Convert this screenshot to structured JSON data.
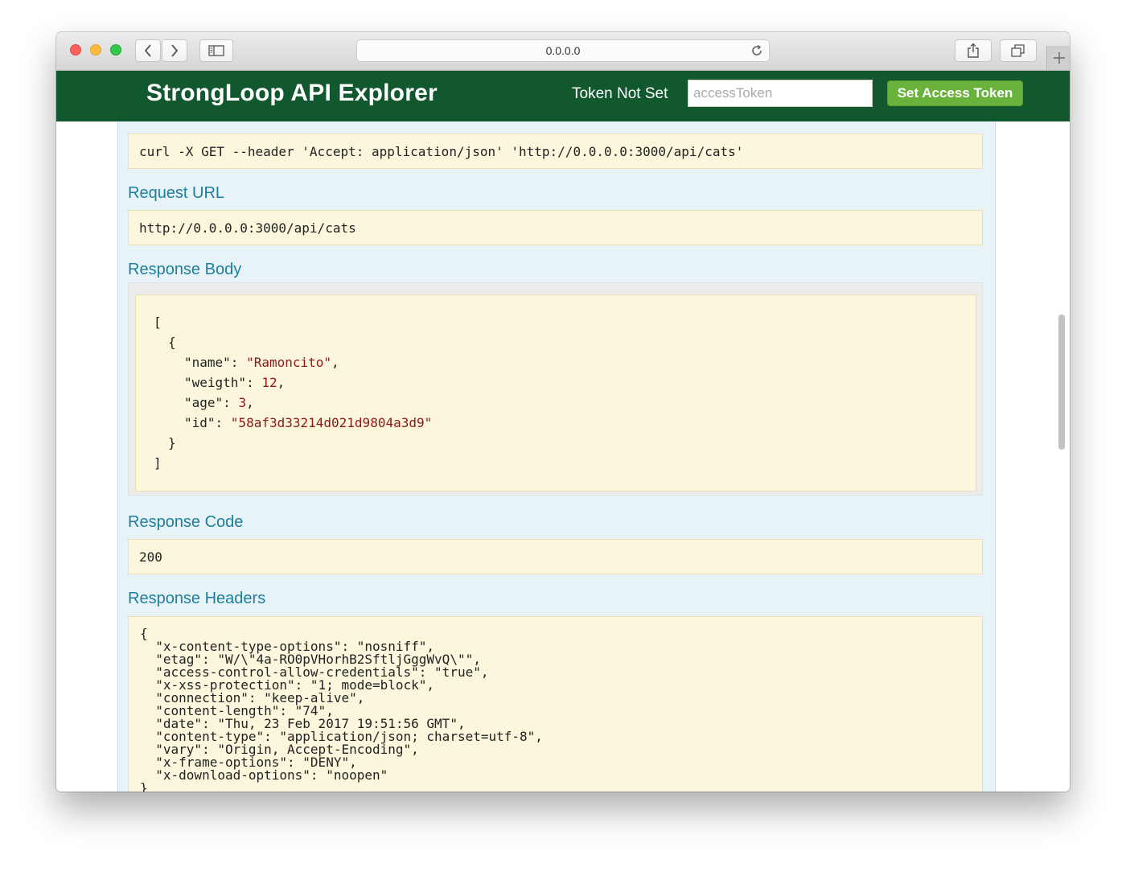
{
  "browser": {
    "url": "0.0.0.0"
  },
  "header": {
    "title": "StrongLoop API Explorer",
    "token_status": "Token Not Set",
    "token_placeholder": "accessToken",
    "set_token_label": "Set Access Token",
    "brand_color": "#11582e",
    "button_color": "#69b33c"
  },
  "curl": {
    "command": "curl -X GET --header 'Accept: application/json' 'http://0.0.0.0:3000/api/cats'"
  },
  "request_url": {
    "heading": "Request URL",
    "value": "http://0.0.0.0:3000/api/cats"
  },
  "response_body": {
    "heading": "Response Body",
    "open_bracket": "[",
    "open_brace": "{",
    "close_brace": "}",
    "close_bracket": "]",
    "fields": [
      {
        "key": "\"name\"",
        "value": "\"Ramoncito\"",
        "sep": ","
      },
      {
        "key": "\"weigth\"",
        "value": "12",
        "sep": ","
      },
      {
        "key": "\"age\"",
        "value": "3",
        "sep": ","
      },
      {
        "key": "\"id\"",
        "value": "\"58af3d33214d021d9804a3d9\"",
        "sep": ""
      }
    ]
  },
  "response_code": {
    "heading": "Response Code",
    "value": "200"
  },
  "response_headers": {
    "heading": "Response Headers",
    "lines": [
      "{",
      "  \"x-content-type-options\": \"nosniff\",",
      "  \"etag\": \"W/\\\"4a-RO0pVHorhB2SftljGggWvQ\\\"\",",
      "  \"access-control-allow-credentials\": \"true\",",
      "  \"x-xss-protection\": \"1; mode=block\",",
      "  \"connection\": \"keep-alive\",",
      "  \"content-length\": \"74\",",
      "  \"date\": \"Thu, 23 Feb 2017 19:51:56 GMT\",",
      "  \"content-type\": \"application/json; charset=utf-8\",",
      "  \"vary\": \"Origin, Accept-Encoding\",",
      "  \"x-frame-options\": \"DENY\",",
      "  \"x-download-options\": \"noopen\"",
      "}"
    ]
  }
}
